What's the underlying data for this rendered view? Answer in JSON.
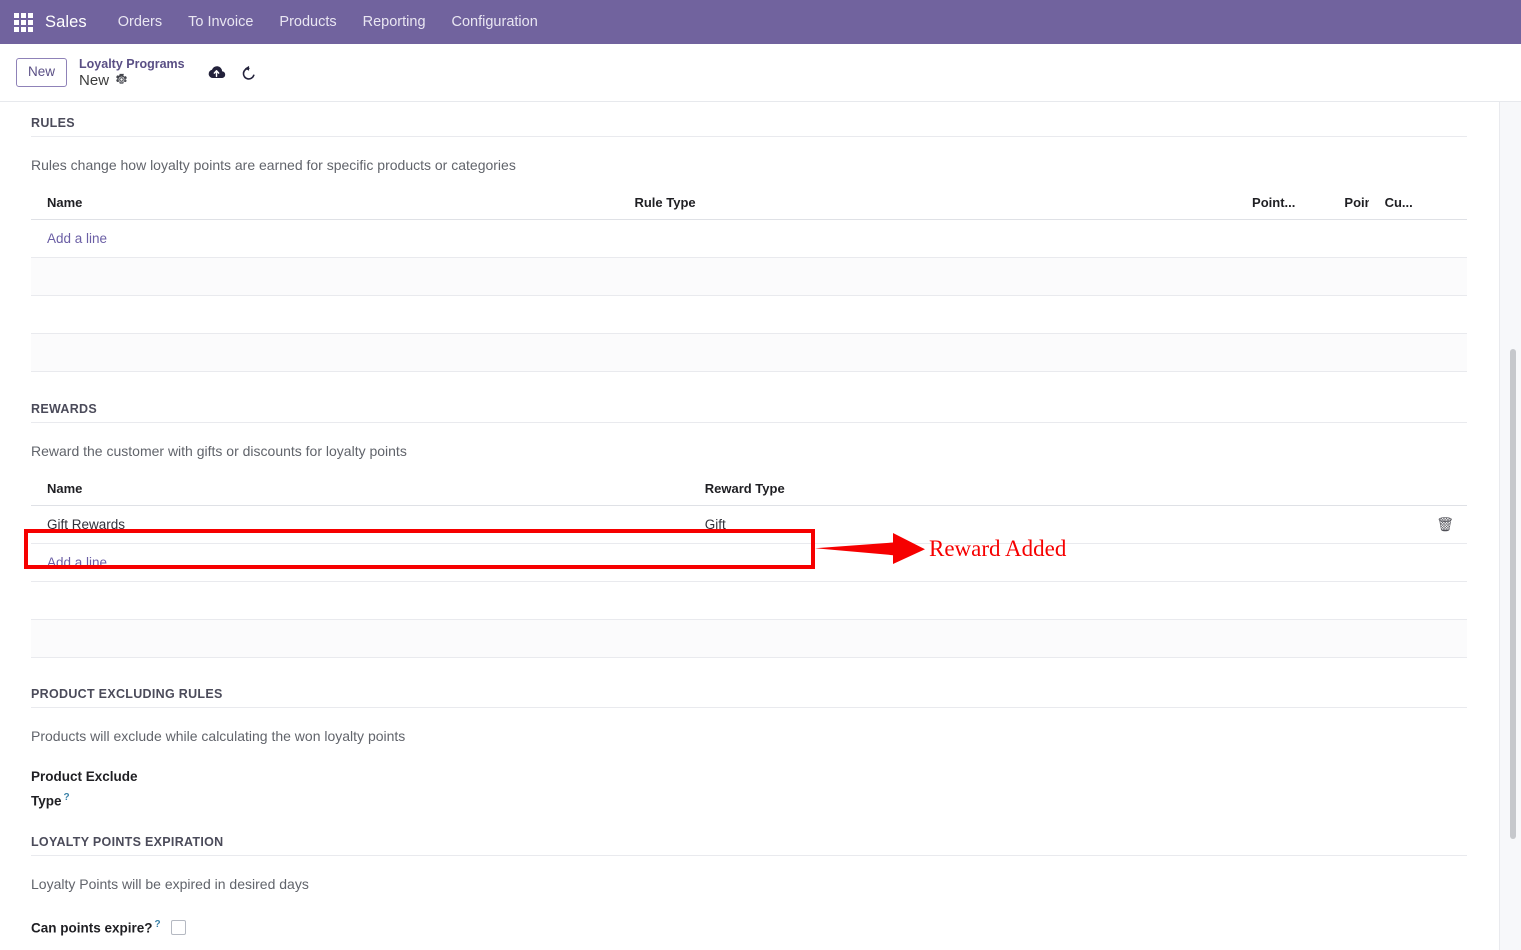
{
  "navbar": {
    "apps_icon": "apps-grid-icon",
    "brand": "Sales",
    "menus": [
      {
        "label": "Orders"
      },
      {
        "label": "To Invoice"
      },
      {
        "label": "Products"
      },
      {
        "label": "Reporting"
      },
      {
        "label": "Configuration"
      }
    ]
  },
  "control_panel": {
    "new_button": "New",
    "breadcrumb_parent": "Loyalty Programs",
    "breadcrumb_current": "New",
    "gear_icon": "gear-icon",
    "save_icon": "cloud-upload-icon",
    "discard_icon": "undo-arrow-icon"
  },
  "rules": {
    "title": "RULES",
    "description": "Rules change how loyalty points are earned for specific products or categories",
    "columns": [
      "Name",
      "Rule Type",
      "Point...",
      "Point...",
      "Cu..."
    ],
    "rows": [],
    "add_line": "Add a line"
  },
  "rewards": {
    "title": "REWARDS",
    "description": "Reward the customer with gifts or discounts for loyalty points",
    "columns": [
      "Name",
      "Reward Type"
    ],
    "rows": [
      {
        "name": "Gift Rewards",
        "reward_type": "Gift",
        "delete_icon": "trash-icon"
      }
    ],
    "add_line": "Add a line"
  },
  "product_excluding_rules": {
    "title": "PRODUCT EXCLUDING RULES",
    "description": "Products will exclude while calculating the won loyalty points",
    "field_label_line1": "Product Exclude",
    "field_label_line2": "Type",
    "help_mark": "?"
  },
  "loyalty_points_expiration": {
    "title": "LOYALTY POINTS EXPIRATION",
    "description": "Loyalty Points will be expired in desired days",
    "field_label": "Can points expire?",
    "help_mark": "?",
    "checked": false
  },
  "annotation": {
    "label": "Reward Added",
    "color": "#f60000"
  },
  "colors": {
    "navbar_bg": "#71639e",
    "accent": "#71639e",
    "link": "#6b5fa5",
    "annotation_red": "#f60000"
  }
}
